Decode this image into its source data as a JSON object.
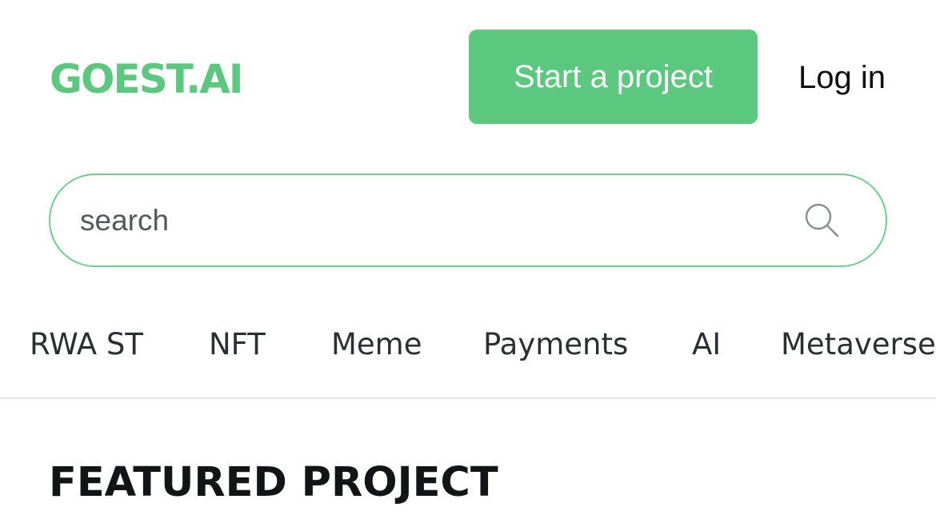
{
  "header": {
    "logo": "GOEST.AI",
    "start_button_label": "Start a project",
    "login_label": "Log in"
  },
  "search": {
    "placeholder": "search",
    "value": "",
    "icon": "search-icon"
  },
  "categories": [
    {
      "label": "RWA ST"
    },
    {
      "label": "NFT"
    },
    {
      "label": "Meme"
    },
    {
      "label": "Payments"
    },
    {
      "label": "AI"
    },
    {
      "label": "Metaverse"
    }
  ],
  "featured": {
    "title": "FEATURED PROJECT"
  },
  "colors": {
    "accent": "#5bc77f",
    "search_border": "#6ccf8c",
    "text": "#2b2f33",
    "divider": "#e6e8ea"
  }
}
